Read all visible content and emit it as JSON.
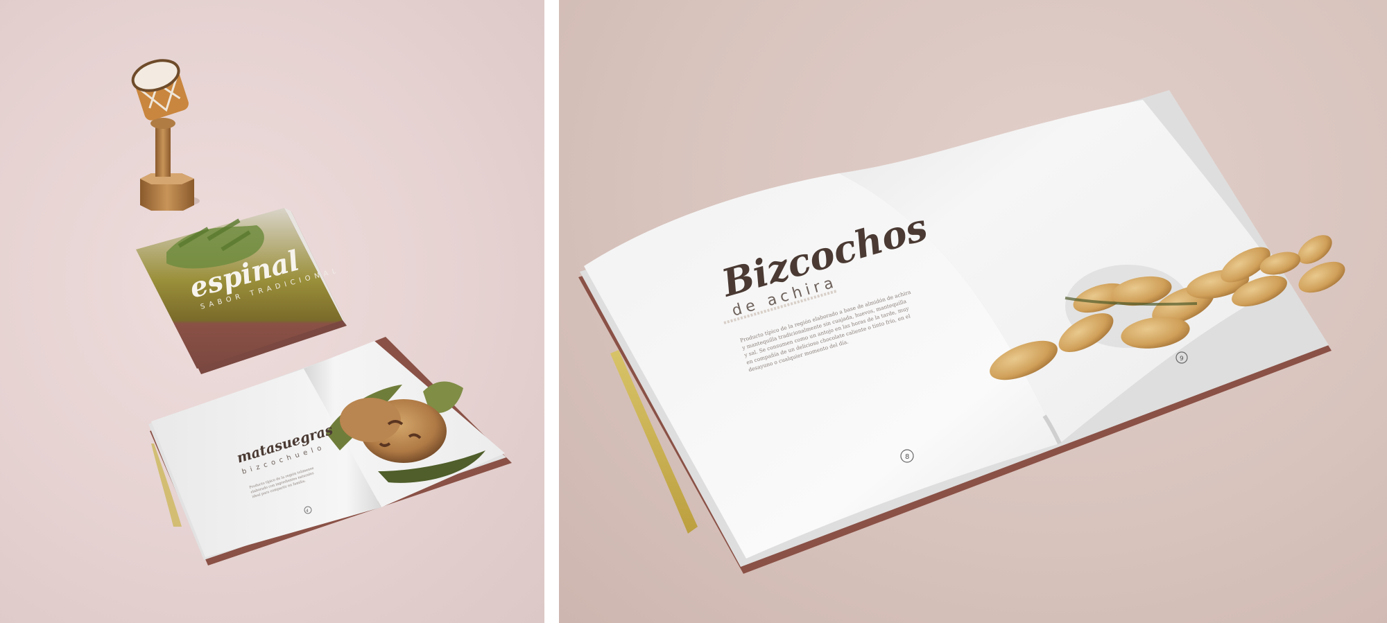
{
  "left_scene": {
    "cover": {
      "title": "espinal",
      "subtitle": "SABOR TRADICIONAL"
    },
    "spread": {
      "title": "matasuegras",
      "subtitle": "bizcochuelo",
      "body_lines": [
        "Producto típico de la región tolimense",
        "elaborado con ingredientes naturales",
        "ideal para compartir en familia."
      ],
      "page_number": "4"
    }
  },
  "right_scene": {
    "spread": {
      "title": "Bizcochos",
      "subtitle": "de achira",
      "body_lines": [
        "Producto típico de la región elaborado a base de almidón de achira",
        "y mantequilla tradicionalmente sin cuajada, huevos, mantequilla",
        "y sal. Se consumen como un antojo en las horas de la tarde, muy",
        "en compañía de un delicioso chocolate caliente o tinto frío, en el",
        "desayuno o cualquier momento del día."
      ],
      "page_left": "8",
      "page_right": "9"
    }
  },
  "colors": {
    "left_background": "#e8d6d5",
    "right_background": "#dac6c0",
    "title_brown": "#4a3a33",
    "cover_brown": "#8a5146",
    "page_white": "#f4f4f4"
  }
}
